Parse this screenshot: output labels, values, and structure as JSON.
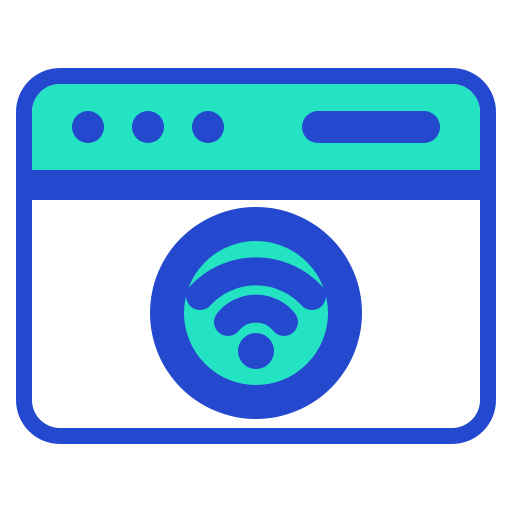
{
  "icon": {
    "name": "browser-window-wifi-icon",
    "colors": {
      "outline": "#2449CF",
      "accent": "#24E3C3",
      "fill": "#FFFFFF"
    },
    "parts": {
      "window": "browser-window",
      "title_bar_dots": [
        "window-dot",
        "window-dot",
        "window-dot"
      ],
      "address_bar": "address-bar",
      "badge": "wifi-badge",
      "signal": "wifi-icon"
    }
  }
}
